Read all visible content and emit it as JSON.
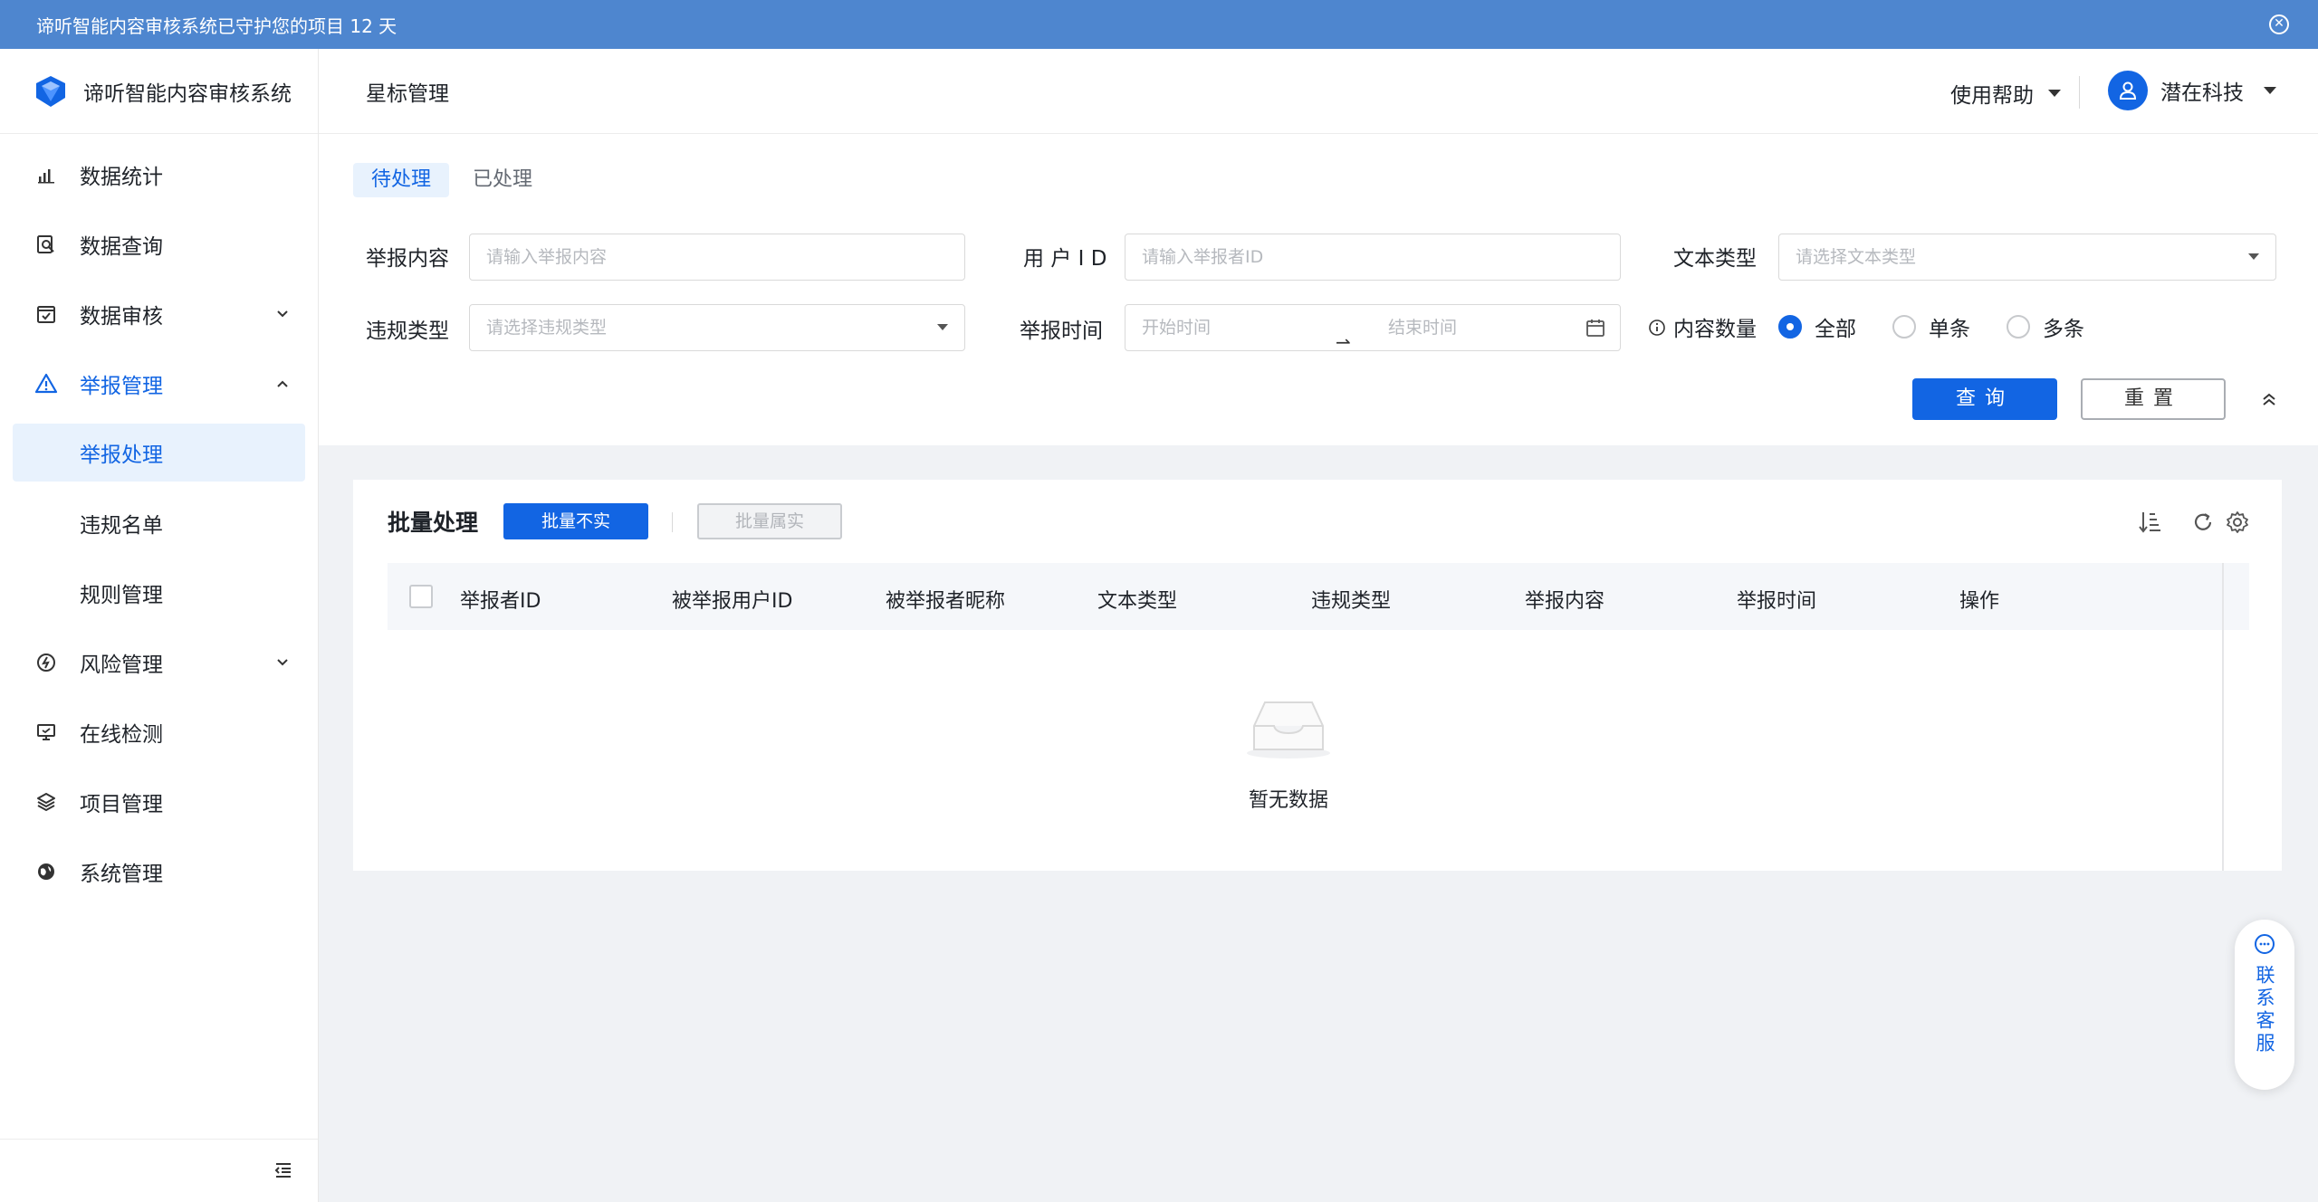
{
  "banner": {
    "text": "谛听智能内容审核系统已守护您的项目 12 天"
  },
  "app": {
    "name": "谛听智能内容审核系统"
  },
  "header": {
    "title": "星标管理",
    "help": "使用帮助",
    "user": "潜在科技"
  },
  "sidebar": {
    "items": [
      {
        "label": "数据统计",
        "icon": "bar-chart-icon"
      },
      {
        "label": "数据查询",
        "icon": "search-doc-icon"
      },
      {
        "label": "数据审核",
        "icon": "check-box-icon",
        "expandable": true
      },
      {
        "label": "举报管理",
        "icon": "warning-icon",
        "expanded": true,
        "active": true,
        "children": [
          {
            "label": "举报处理",
            "active": true
          },
          {
            "label": "违规名单"
          },
          {
            "label": "规则管理"
          }
        ]
      },
      {
        "label": "风险管理",
        "icon": "risk-icon",
        "expandable": true
      },
      {
        "label": "在线检测",
        "icon": "monitor-icon"
      },
      {
        "label": "项目管理",
        "icon": "layers-icon"
      },
      {
        "label": "系统管理",
        "icon": "globe-icon"
      }
    ]
  },
  "tabs": [
    {
      "label": "待处理",
      "active": true
    },
    {
      "label": "已处理"
    }
  ],
  "filters": {
    "content_label": "举报内容",
    "content_placeholder": "请输入举报内容",
    "userid_label": "用 户 I D",
    "userid_placeholder": "请输入举报者ID",
    "texttype_label": "文本类型",
    "texttype_placeholder": "请选择文本类型",
    "violation_label": "违规类型",
    "violation_placeholder": "请选择违规类型",
    "time_label": "举报时间",
    "time_start": "开始时间",
    "time_end": "结束时间",
    "time_arrow": "⇀",
    "count_label": "内容数量",
    "count_options": [
      {
        "label": "全部",
        "checked": true
      },
      {
        "label": "单条"
      },
      {
        "label": "多条"
      }
    ],
    "query": "查询",
    "reset": "重置"
  },
  "table": {
    "title": "批量处理",
    "bulk_false": "批量不实",
    "bulk_true": "批量属实",
    "columns": [
      "举报者ID",
      "被举报用户ID",
      "被举报者昵称",
      "文本类型",
      "违规类型",
      "举报内容",
      "举报时间",
      "操作"
    ],
    "empty": "暂无数据"
  },
  "support": {
    "label": "联系客服"
  },
  "colors": {
    "primary": "#1265e3",
    "banner": "#4e86cf",
    "active_bg": "#e8f2fd"
  }
}
